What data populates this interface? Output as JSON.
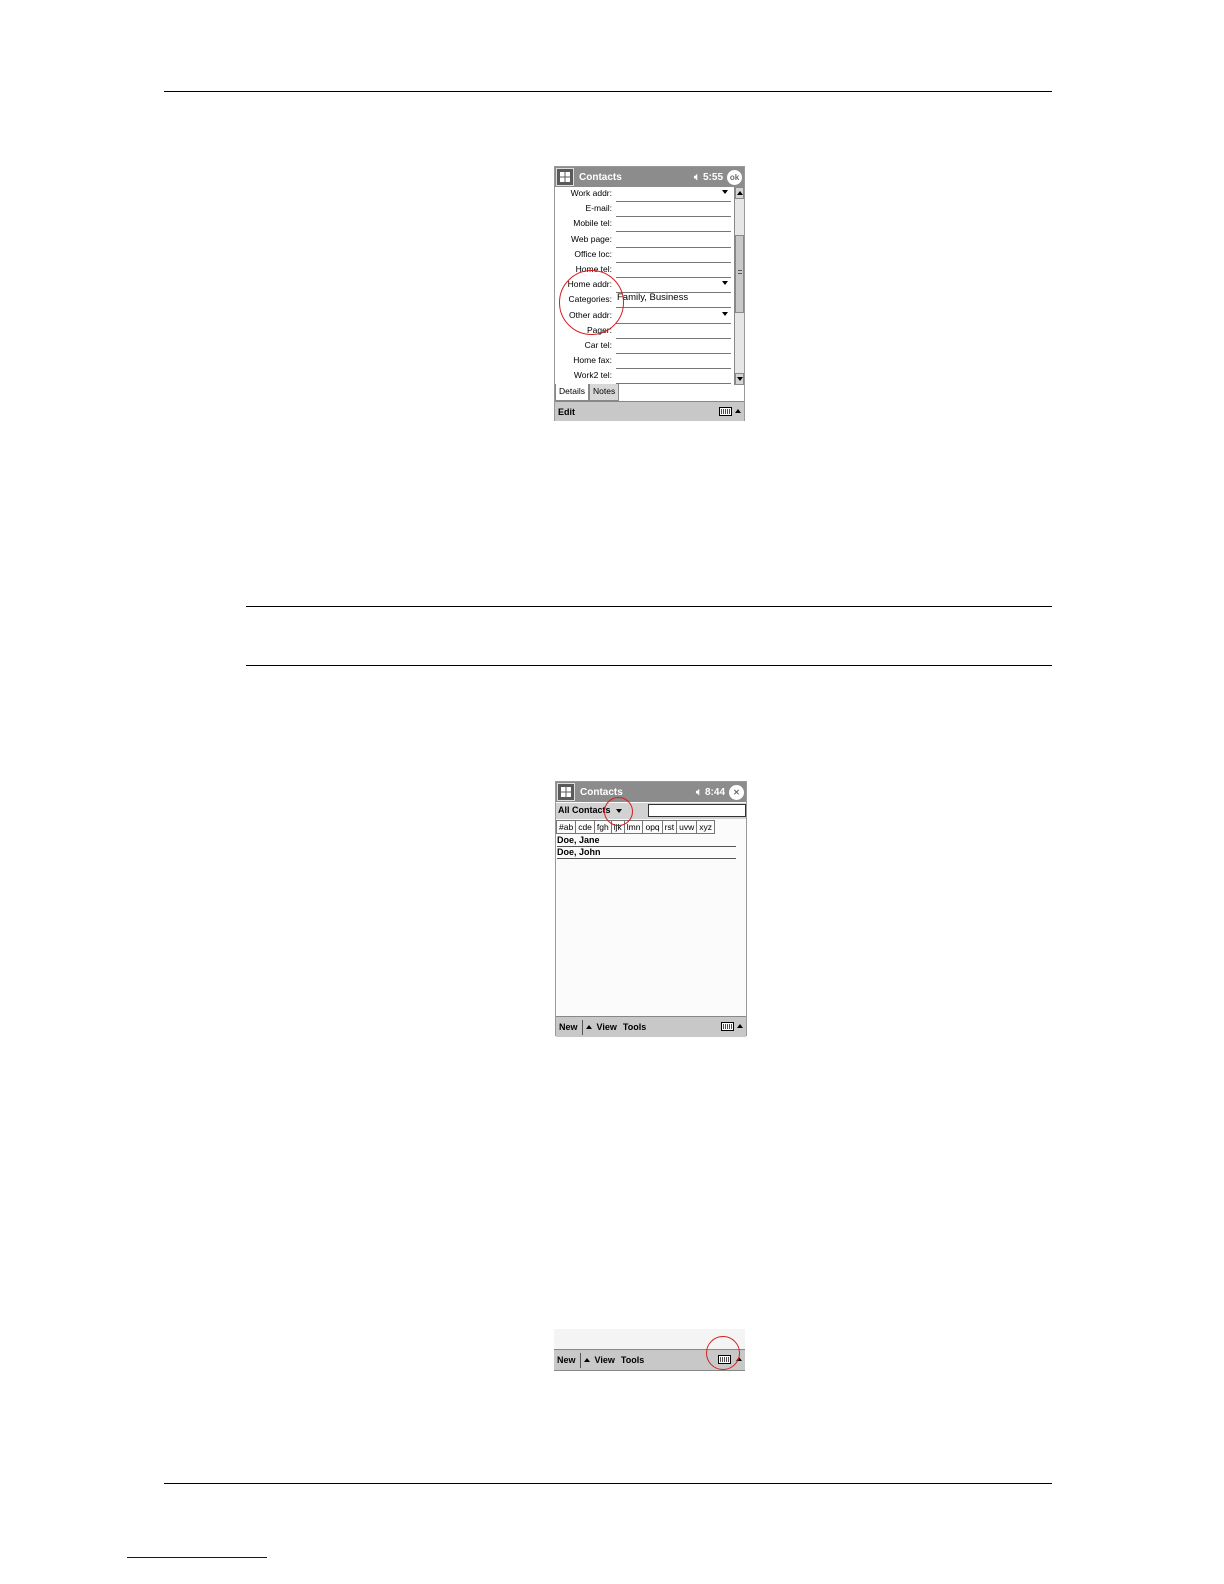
{
  "screen1": {
    "title": "Contacts",
    "time": "5:55",
    "ok_label": "ok",
    "fields": [
      {
        "label": "Work addr:",
        "value": "",
        "dropdown": true
      },
      {
        "label": "E-mail:",
        "value": "",
        "dropdown": false
      },
      {
        "label": "Mobile tel:",
        "value": "",
        "dropdown": false
      },
      {
        "label": "Web page:",
        "value": "",
        "dropdown": false
      },
      {
        "label": "Office loc:",
        "value": "",
        "dropdown": false
      },
      {
        "label": "Home tel:",
        "value": "",
        "dropdown": false
      },
      {
        "label": "Home addr:",
        "value": "",
        "dropdown": true
      },
      {
        "label": "Categories:",
        "value": "Family, Business",
        "dropdown": false
      },
      {
        "label": "Other addr:",
        "value": "",
        "dropdown": true
      },
      {
        "label": "Pager:",
        "value": "",
        "dropdown": false
      },
      {
        "label": "Car tel:",
        "value": "",
        "dropdown": false
      },
      {
        "label": "Home fax:",
        "value": "",
        "dropdown": false
      },
      {
        "label": "Work2 tel:",
        "value": "",
        "dropdown": false
      }
    ],
    "tabs": [
      "Details",
      "Notes"
    ],
    "menu": [
      "Edit"
    ]
  },
  "screen2": {
    "title": "Contacts",
    "time": "8:44",
    "filter_label": "All Contacts",
    "alpha_tabs": [
      "#ab",
      "cde",
      "fgh",
      "ijk",
      "lmn",
      "opq",
      "rst",
      "uvw",
      "xyz"
    ],
    "contacts": [
      "Doe, Jane",
      "Doe, John"
    ],
    "menu": {
      "new": "New",
      "view": "View",
      "tools": "Tools"
    }
  },
  "screen3": {
    "menu": {
      "new": "New",
      "view": "View",
      "tools": "Tools"
    }
  }
}
